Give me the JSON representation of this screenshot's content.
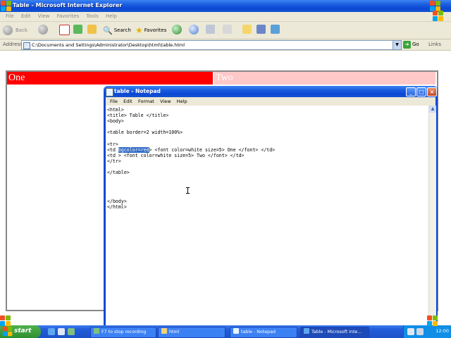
{
  "ie": {
    "title": "Table - Microsoft Internet Explorer",
    "menu": [
      "File",
      "Edit",
      "View",
      "Favorites",
      "Tools",
      "Help"
    ],
    "toolbar": {
      "back": "Back",
      "search": "Search",
      "favorites": "Favorites"
    },
    "address_label": "Address",
    "address": "C:\\Documents and Settings\\Administrator\\Desktop\\html\\table.html",
    "go": "Go",
    "links": "Links",
    "table": {
      "cell_one": "One",
      "cell_two": "Two",
      "cell_one_color": "#ff0000",
      "cell_two_color": "#ffc8c8"
    }
  },
  "notepad": {
    "title": "table - Notepad",
    "menu": [
      "File",
      "Edit",
      "Format",
      "View",
      "Help"
    ],
    "code_before": "<html>\n<title> Table </title>\n<body>\n\n<table border=2 width=100%>\n\n<tr>\n<td ",
    "selected": "bgcolor=red",
    "code_after": "> <font color=white size=5> One </font> </td>\n<td > <font color=white size=5> Two </font> </td>\n</tr>\n\n</table>\n\n\n\n\n</body>\n</html>",
    "selection_color": "#316ac5"
  },
  "taskbar": {
    "start": "start",
    "tasks": [
      {
        "label": "F7 to stop recording"
      },
      {
        "label": "html"
      },
      {
        "label": "table - Notepad"
      },
      {
        "label": "Table - Microsoft Inte..."
      }
    ],
    "clock": "12:00"
  },
  "colors": {
    "xp_blue": "#0b48d4",
    "taskbar": "#245edb",
    "start_green": "#2e8f2e"
  }
}
